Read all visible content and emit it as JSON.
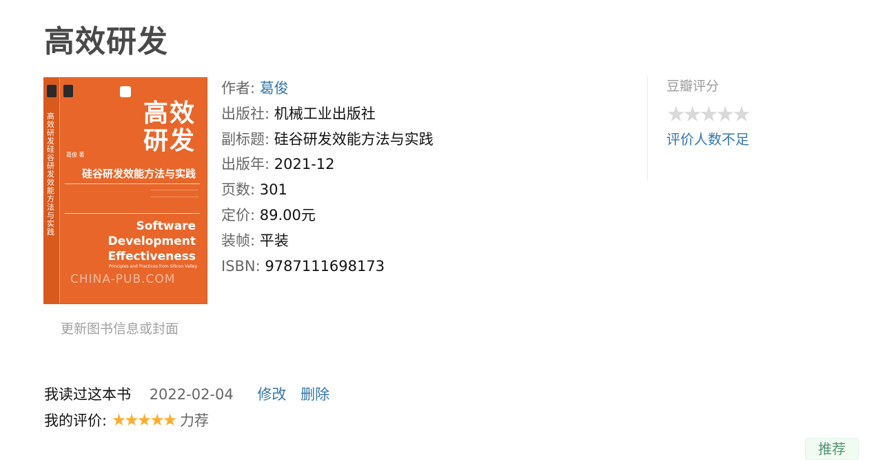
{
  "book": {
    "title": "高效研发",
    "cover": {
      "title_line1": "高效",
      "title_line2": "研发",
      "subtitle": "硅谷研发效能方法与实践",
      "english_1": "Software",
      "english_2": "Development",
      "english_3": "Effectiveness",
      "english_sub": "Principles and Practices from Silicon Valley",
      "watermark": "CHINA-PUB.COM",
      "spine_text": "高效研发硅谷研发效能方法与实践",
      "author_mark": "葛俊 著"
    },
    "update_link": "更新图书信息或封面",
    "info": {
      "author_label": "作者:",
      "author": "葛俊",
      "publisher_label": "出版社:",
      "publisher": "机械工业出版社",
      "subtitle_label": "副标题:",
      "subtitle": "硅谷研发效能方法与实践",
      "year_label": "出版年:",
      "year": "2021-12",
      "pages_label": "页数:",
      "pages": "301",
      "price_label": "定价:",
      "price": "89.00元",
      "binding_label": "装帧:",
      "binding": "平装",
      "isbn_label": "ISBN:",
      "isbn": "9787111698173"
    }
  },
  "rating": {
    "title": "豆瓣评分",
    "stars": "★★★★★",
    "not_enough": "评价人数不足"
  },
  "my_status": {
    "status": "我读过这本书",
    "date": "2022-02-04",
    "edit": "修改",
    "delete": "删除",
    "rating_label": "我的评价:",
    "rating_stars": "★★★★★",
    "rating_text": "力荐",
    "rating_value": 5,
    "recommend_button": "推荐"
  },
  "colors": {
    "link": "#3377aa",
    "cover_orange": "#e8662a",
    "star_gold": "#ffac2d",
    "star_gray": "#d9d9d9"
  }
}
